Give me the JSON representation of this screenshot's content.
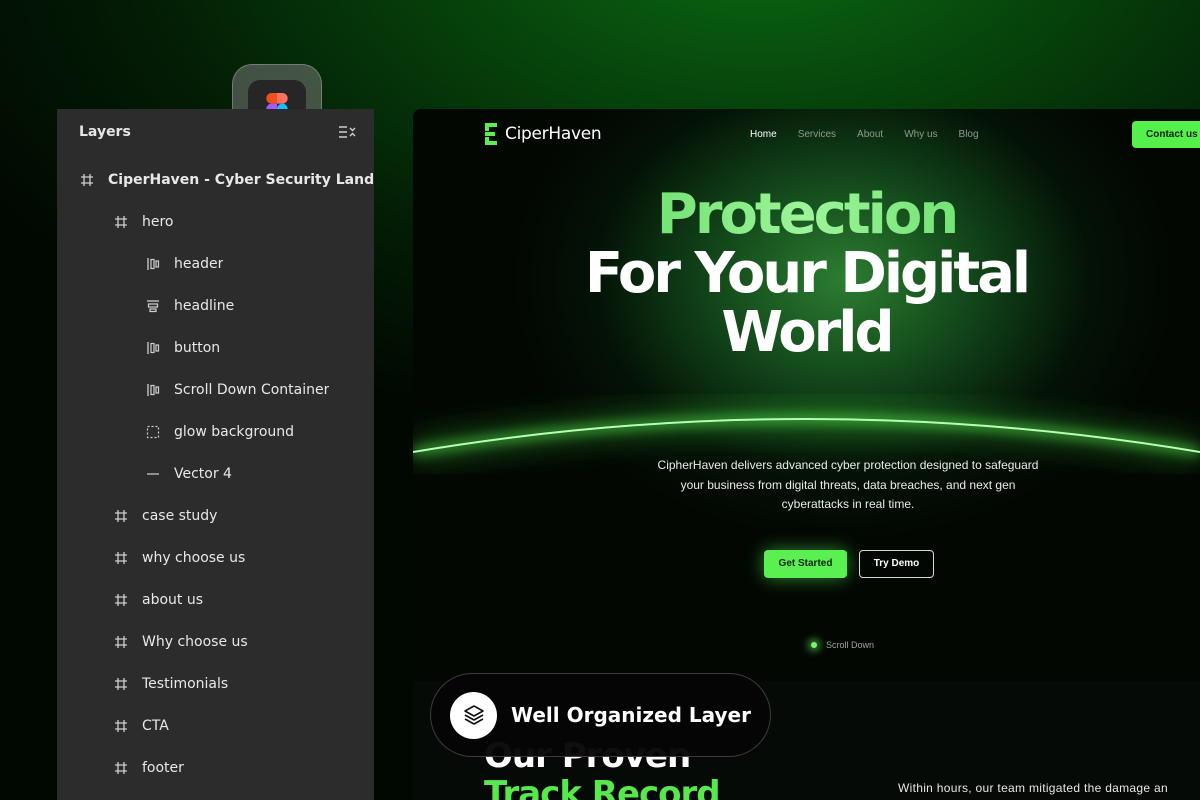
{
  "layers_panel": {
    "title": "Layers",
    "items": [
      {
        "label": "CiperHaven - Cyber Security Landing",
        "icon": "frame-icon",
        "level": "root"
      },
      {
        "label": "hero",
        "icon": "frame-icon",
        "level": "child"
      },
      {
        "label": "header",
        "icon": "auto-layout-horizontal-icon",
        "level": "grandchild"
      },
      {
        "label": "headline",
        "icon": "auto-layout-vertical-icon",
        "level": "grandchild"
      },
      {
        "label": "button",
        "icon": "auto-layout-horizontal-icon",
        "level": "grandchild"
      },
      {
        "label": "Scroll Down Container",
        "icon": "auto-layout-horizontal-icon",
        "level": "grandchild"
      },
      {
        "label": "glow background",
        "icon": "dashed-rectangle-icon",
        "level": "grandchild"
      },
      {
        "label": "Vector 4",
        "icon": "vector-line-icon",
        "level": "grandchild"
      },
      {
        "label": "case study",
        "icon": "frame-icon",
        "level": "child"
      },
      {
        "label": "why choose us",
        "icon": "frame-icon",
        "level": "child"
      },
      {
        "label": "about us",
        "icon": "frame-icon",
        "level": "child"
      },
      {
        "label": "Why choose us",
        "icon": "frame-icon",
        "level": "child"
      },
      {
        "label": "Testimonials",
        "icon": "frame-icon",
        "level": "child"
      },
      {
        "label": "CTA",
        "icon": "frame-icon",
        "level": "child"
      },
      {
        "label": "footer",
        "icon": "frame-icon",
        "level": "child"
      }
    ]
  },
  "preview": {
    "brand": {
      "prefix": "Ciper",
      "suffix": "Haven"
    },
    "nav": [
      "Home",
      "Services",
      "About",
      "Why us",
      "Blog"
    ],
    "contact_button": "Contact us",
    "headline": {
      "accent": "Protection",
      "line2": "For Your Digital",
      "line3": "World"
    },
    "description": "CipherHaven delivers advanced cyber protection designed to safeguard your business from digital threats, data breaches, and next gen cyberattacks in real time.",
    "primary_button": "Get Started",
    "secondary_button": "Try Demo",
    "scroll_label": "Scroll Down",
    "track_record": {
      "line1": "Our Proven",
      "line2": "Track Record"
    },
    "case_text": "Within hours, our team mitigated the damage an"
  },
  "badge": {
    "text": "Well Organized Layer",
    "icon": "layers-icon"
  },
  "colors": {
    "accent": "#56f04c",
    "panel_bg": "#2c2c2c",
    "page_bg": "#06420b"
  }
}
